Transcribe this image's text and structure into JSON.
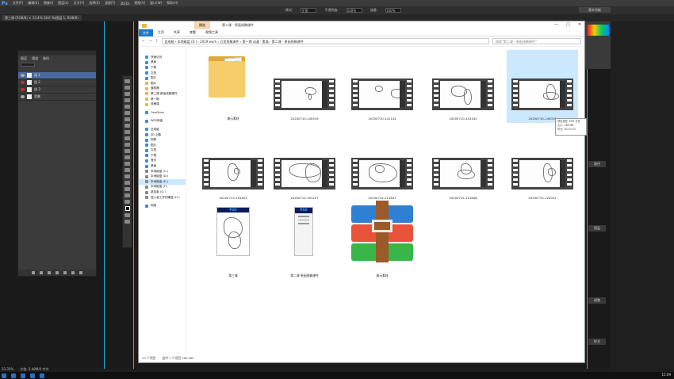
{
  "ps": {
    "logo": "Ps",
    "menu": [
      "文件(F)",
      "编辑(E)",
      "图像(I)",
      "图层(L)",
      "文字(Y)",
      "选择(S)",
      "滤镜(T)",
      "3D(D)",
      "视图(V)",
      "窗口(W)",
      "帮助(H)"
    ],
    "options": [
      "模式:",
      "正常",
      "不透明度:",
      "100%",
      "流量:",
      "100%"
    ],
    "workspace": "基本功能",
    "doc_tab": "第三课 (RGB/8) × 33.4% 18.6 %(图层 1, RGB/8)",
    "status": [
      "33.33%",
      "文档: 3.48M/0 字节"
    ],
    "layers_tabs": [
      "图层",
      "通道",
      "路径"
    ],
    "layers": [
      {
        "name": "组 1",
        "active": true,
        "eye": "normal"
      },
      {
        "name": "组 2",
        "active": false,
        "eye": "red"
      },
      {
        "name": "组 3",
        "active": false,
        "eye": "red"
      },
      {
        "name": "背景",
        "active": false,
        "eye": "normal"
      }
    ],
    "right_buttons": [
      "路径",
      "图层",
      "调整",
      "样式"
    ]
  },
  "explorer": {
    "ribbon_highlight": "播放",
    "ribbon_sub": "视频工具",
    "title": "第二课 - 原画线稿课件",
    "window_controls": [
      "—",
      "□",
      "✕"
    ],
    "tabs": [
      "文件",
      "主页",
      "共享",
      "查看",
      "视频工具"
    ],
    "address": "此电脑 › 本地磁盘 (E:) › 2019 work › 已发线稿课件 › 第一期 动漫 · 素描 › 第二课 · 原画线稿课件",
    "search_placeholder": "搜索\"第二课 - 原画线稿课件\"",
    "nav": [
      {
        "label": "快速访问",
        "color": "#3d8be0"
      },
      {
        "label": "桌面",
        "color": "#3d8be0"
      },
      {
        "label": "下载",
        "color": "#3d8be0"
      },
      {
        "label": "文档",
        "color": "#3d8be0"
      },
      {
        "label": "图片",
        "color": "#3d8be0"
      },
      {
        "label": "图片",
        "color": "#e8b84b"
      },
      {
        "label": "播放器",
        "color": "#e8b84b"
      },
      {
        "label": "第二课 原画线稿课件",
        "color": "#e8b84b"
      },
      {
        "label": "第一期",
        "color": "#e8b84b"
      },
      {
        "label": "线稿课",
        "color": "#e8b84b"
      },
      {
        "label": "",
        "color": ""
      },
      {
        "label": "OneDrive",
        "color": "#3d8be0"
      },
      {
        "label": "",
        "color": ""
      },
      {
        "label": "WPS网盘",
        "color": "#3d8be0"
      },
      {
        "label": "",
        "color": ""
      },
      {
        "label": "此电脑",
        "color": "#3d8be0"
      },
      {
        "label": "3D 对象",
        "color": "#3d8be0"
      },
      {
        "label": "视频",
        "color": "#3d8be0"
      },
      {
        "label": "图片",
        "color": "#3d8be0"
      },
      {
        "label": "文档",
        "color": "#3d8be0"
      },
      {
        "label": "下载",
        "color": "#3d8be0"
      },
      {
        "label": "音乐",
        "color": "#3d8be0"
      },
      {
        "label": "桌面",
        "color": "#3d8be0"
      },
      {
        "label": "本地磁盘 (C:)",
        "color": "#888888"
      },
      {
        "label": "本地磁盘 (D:)",
        "color": "#888888"
      },
      {
        "label": "本地磁盘 (E:)",
        "color": "#888888",
        "selected": true
      },
      {
        "label": "本地磁盘 (F:)",
        "color": "#888888"
      },
      {
        "label": "新加卷 (G:)",
        "color": "#888888"
      },
      {
        "label": "插入我工作的硬盘 (H:)",
        "color": "#888888"
      },
      {
        "label": "",
        "color": ""
      },
      {
        "label": "网络",
        "color": "#3d8be0"
      }
    ],
    "files": [
      {
        "label": "演示素材",
        "kind": "folder"
      },
      {
        "label": "20200710-140519",
        "kind": "video"
      },
      {
        "label": "20200710-141144",
        "kind": "video"
      },
      {
        "label": "20200710-143442",
        "kind": "video"
      },
      {
        "label": "20200710-145019",
        "kind": "video",
        "selected": true
      },
      {
        "label": "20200713-154403",
        "kind": "video"
      },
      {
        "label": "20200714-161227",
        "kind": "video"
      },
      {
        "label": "20200714-211847",
        "kind": "video"
      },
      {
        "label": "20200715-115848",
        "kind": "video"
      },
      {
        "label": "20200715-120031",
        "kind": "video"
      },
      {
        "label": "第三课",
        "kind": "psd"
      },
      {
        "label": "第二课 原画线稿课件",
        "kind": "psd2"
      },
      {
        "label": "演示素材",
        "kind": "rar"
      }
    ],
    "tooltip": [
      "项目类型: MP4 文件",
      "大小: 186 MB",
      "时长: 00:43:33"
    ],
    "status": [
      "13 个项目",
      "选中 1 个项目 186 MB"
    ]
  },
  "taskbar": {
    "clock": "15:09"
  },
  "colors": {
    "accent": "#1979ca",
    "selection": "#cce8ff",
    "guide": "#1fb3e6"
  }
}
